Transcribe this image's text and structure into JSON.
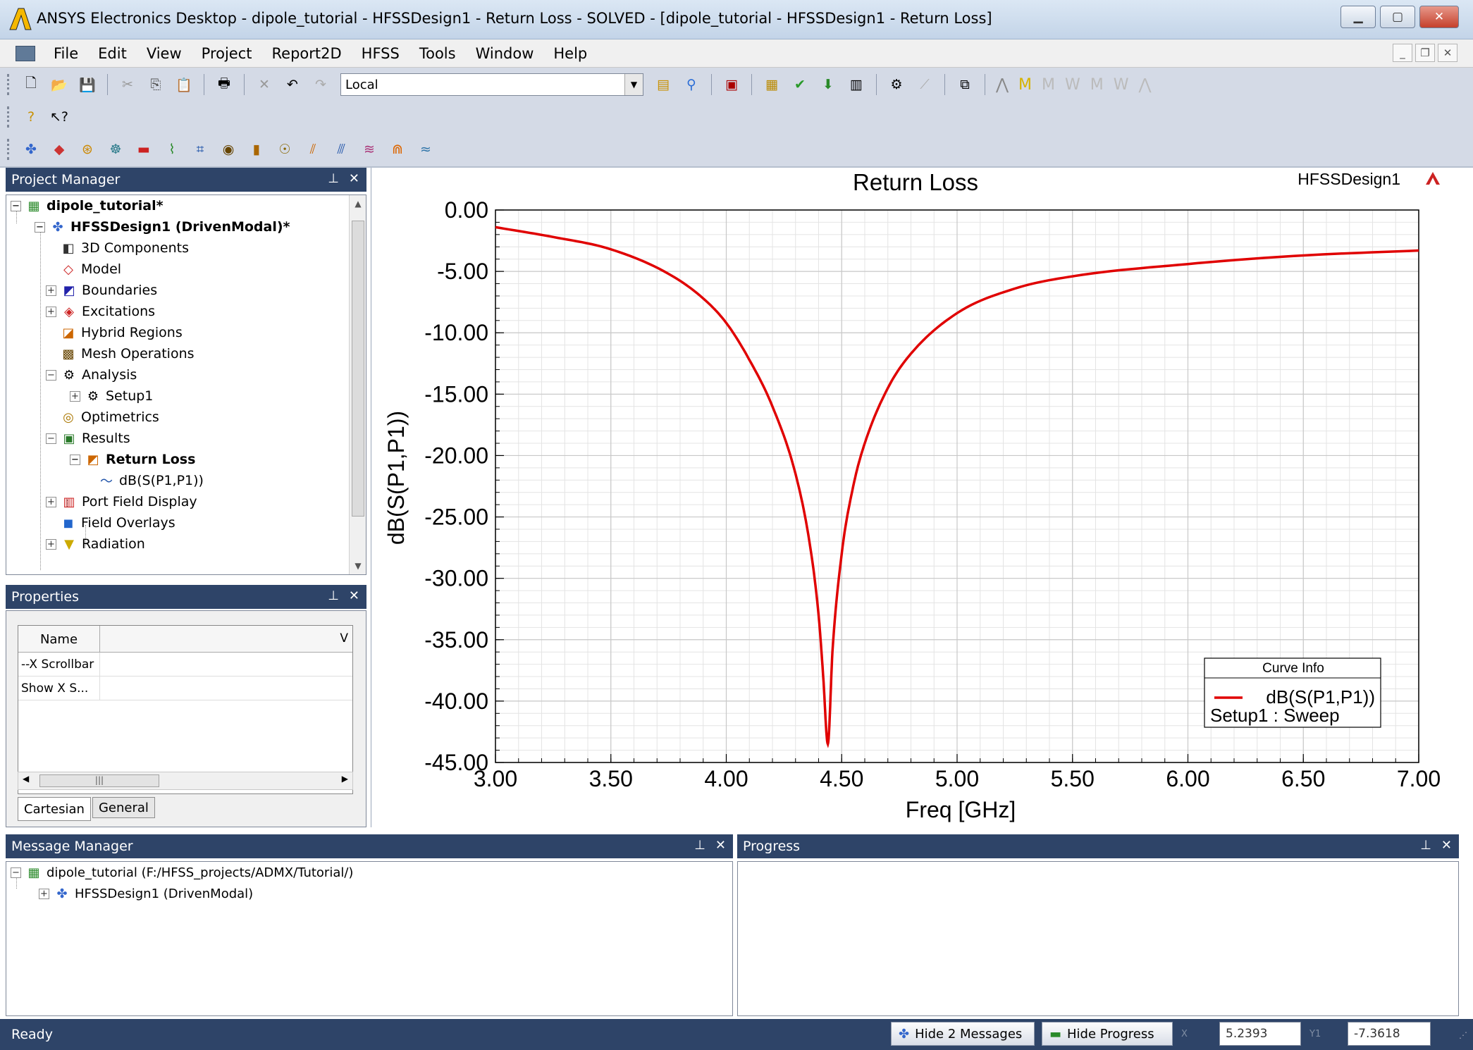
{
  "window": {
    "title": "ANSYS Electronics Desktop - dipole_tutorial - HFSSDesign1 - Return Loss - SOLVED - [dipole_tutorial - HFSSDesign1 - Return Loss]"
  },
  "menu": [
    "File",
    "Edit",
    "View",
    "Project",
    "Report2D",
    "HFSS",
    "Tools",
    "Window",
    "Help"
  ],
  "toolbar": {
    "combo_value": "Local"
  },
  "project_manager": {
    "title": "Project Manager",
    "items": [
      {
        "label": "dipole_tutorial*"
      },
      {
        "label": "HFSSDesign1 (DrivenModal)*"
      },
      {
        "label": "3D Components"
      },
      {
        "label": "Model"
      },
      {
        "label": "Boundaries"
      },
      {
        "label": "Excitations"
      },
      {
        "label": "Hybrid Regions"
      },
      {
        "label": "Mesh Operations"
      },
      {
        "label": "Analysis"
      },
      {
        "label": "Setup1"
      },
      {
        "label": "Optimetrics"
      },
      {
        "label": "Results"
      },
      {
        "label": "Return Loss"
      },
      {
        "label": "dB(S(P1,P1))"
      },
      {
        "label": "Port Field Display"
      },
      {
        "label": "Field Overlays"
      },
      {
        "label": "Radiation"
      }
    ]
  },
  "properties": {
    "title": "Properties",
    "header_name": "Name",
    "header_value": "V",
    "rows": [
      {
        "name": "--X Scrollbar"
      },
      {
        "name": "Show X S..."
      }
    ],
    "tabs": [
      "Cartesian",
      "General"
    ]
  },
  "plot": {
    "design_label": "HFSSDesign1",
    "legend_title": "Curve Info",
    "legend_series": "dB(S(P1,P1))",
    "legend_sub": "Setup1 : Sweep"
  },
  "chart_data": {
    "type": "line",
    "title": "Return Loss",
    "xlabel": "Freq [GHz]",
    "ylabel": "dB(S(P1,P1))",
    "xlim": [
      3.0,
      7.0
    ],
    "ylim": [
      -45.0,
      0.0
    ],
    "x_ticks": [
      "3.00",
      "3.50",
      "4.00",
      "4.50",
      "5.00",
      "5.50",
      "6.00",
      "6.50",
      "7.00"
    ],
    "y_ticks": [
      "0.00",
      "-5.00",
      "-10.00",
      "-15.00",
      "-20.00",
      "-25.00",
      "-30.00",
      "-35.00",
      "-40.00",
      "-45.00"
    ],
    "grid": true,
    "legend_placement": "bottom-right",
    "series": [
      {
        "name": "dB(S(P1,P1))",
        "color": "#e00000",
        "x": [
          3.0,
          3.25,
          3.5,
          3.75,
          3.9,
          4.0,
          4.1,
          4.2,
          4.3,
          4.36,
          4.4,
          4.42,
          4.44,
          4.46,
          4.5,
          4.55,
          4.6,
          4.7,
          4.8,
          5.0,
          5.25,
          5.5,
          6.0,
          6.5,
          7.0
        ],
        "y": [
          -1.4,
          -2.2,
          -3.2,
          -5.2,
          -7.2,
          -9.2,
          -12.2,
          -16.0,
          -21.5,
          -27.0,
          -33.0,
          -38.0,
          -43.5,
          -36.0,
          -28.0,
          -22.5,
          -19.0,
          -14.5,
          -11.7,
          -8.4,
          -6.4,
          -5.4,
          -4.4,
          -3.7,
          -3.3
        ]
      }
    ]
  },
  "message_manager": {
    "title": "Message Manager",
    "items": [
      {
        "label": "dipole_tutorial (F:/HFSS_projects/ADMX/Tutorial/)"
      },
      {
        "label": "HFSSDesign1 (DrivenModal)"
      }
    ]
  },
  "progress": {
    "title": "Progress"
  },
  "status": {
    "ready": "Ready",
    "hide_messages": "Hide 2 Messages",
    "hide_progress": "Hide Progress",
    "x_label": "X",
    "x_value": "5.2393",
    "y_label": "Y1",
    "y_value": "-7.3618"
  }
}
